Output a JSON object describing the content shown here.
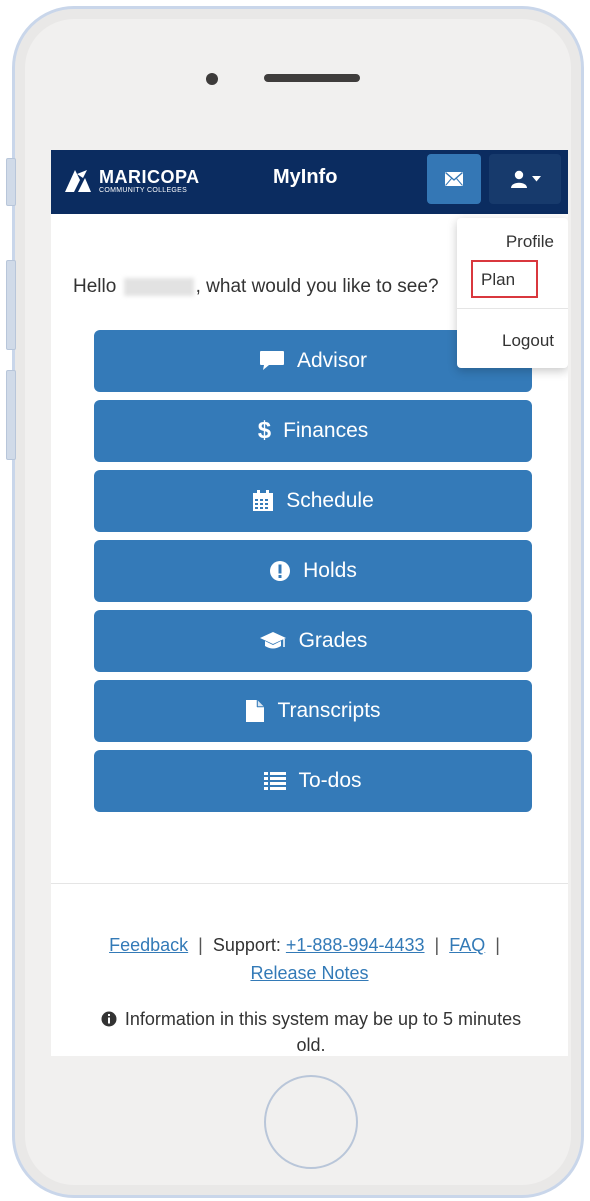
{
  "header": {
    "logo_main": "MARICOPA",
    "logo_sub": "COMMUNITY COLLEGES",
    "app_title": "MyInfo",
    "mail_icon": "envelope-icon",
    "user_icon": "user-icon"
  },
  "user_menu": {
    "items": [
      {
        "label": "Profile"
      },
      {
        "label": "Plan",
        "highlighted": true
      },
      {
        "label": "Logout"
      }
    ],
    "highlight_color": "#d9373d"
  },
  "greeting": {
    "prefix": "Hello",
    "suffix": ", what would you like to see?"
  },
  "menu_buttons": [
    {
      "label": "Advisor",
      "icon": "comment-icon"
    },
    {
      "label": "Finances",
      "icon": "dollar-icon"
    },
    {
      "label": "Schedule",
      "icon": "calendar-icon"
    },
    {
      "label": "Holds",
      "icon": "exclamation-circle-icon"
    },
    {
      "label": "Grades",
      "icon": "graduation-cap-icon"
    },
    {
      "label": "Transcripts",
      "icon": "file-icon"
    },
    {
      "label": "To-dos",
      "icon": "list-icon"
    }
  ],
  "footer": {
    "feedback": "Feedback",
    "support_label": "Support:",
    "phone": "+1-888-994-4433",
    "faq": "FAQ",
    "release_notes": "Release Notes",
    "separator": "|",
    "info_text": "Information in this system may be up to 5 minutes old."
  },
  "colors": {
    "navbar": "#0b2c60",
    "button": "#347ab8",
    "link": "#337ab7"
  }
}
